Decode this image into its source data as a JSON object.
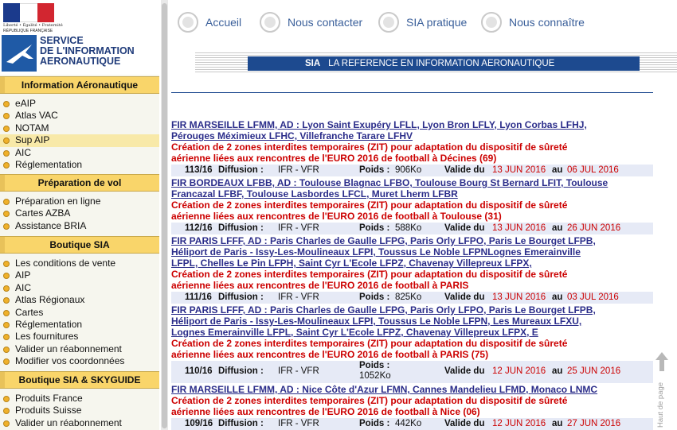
{
  "logo": {
    "motto": "Liberté • Égalité • Fraternité",
    "republic": "RÉPUBLIQUE FRANÇAISE",
    "line1": "SERVICE",
    "line2": "DE L'INFORMATION",
    "line3": "AERONAUTIQUE"
  },
  "sidebar": {
    "sections": [
      {
        "title": "Information Aéronautique",
        "items": [
          "eAIP",
          "Atlas VAC",
          "NOTAM",
          "Sup AIP",
          "AIC",
          "Réglementation"
        ]
      },
      {
        "title": "Préparation de vol",
        "items": [
          "Préparation en ligne",
          "Cartes AZBA",
          "Assistance BRIA"
        ]
      },
      {
        "title": "Boutique SIA",
        "items": [
          "Les conditions de vente",
          "AIP",
          "AIC",
          "Atlas Régionaux",
          "Cartes",
          "Réglementation",
          "Les fournitures",
          "Valider un réabonnement",
          "Modifier vos coordonnées"
        ]
      },
      {
        "title": "Boutique SIA & SKYGUIDE",
        "items": [
          "Produits France",
          "Produits Suisse",
          "Valider un réabonnement"
        ]
      }
    ]
  },
  "nav": {
    "accueil": "Accueil",
    "contact": "Nous contacter",
    "pratique": "SIA pratique",
    "connaitre": "Nous connaître"
  },
  "banner": {
    "sia": "SIA",
    "tagline": "LA REFERENCE EN INFORMATION AERONAUTIQUE"
  },
  "labels": {
    "diffusion": "Diffusion :",
    "poids": "Poids :",
    "valide": "Valide du",
    "au": "au",
    "haut_de_page": "Haut de page"
  },
  "entries": [
    {
      "title": "FIR MARSEILLE LFMM, AD : Lyon Saint Exupéry LFLL, Lyon Bron LFLY, Lyon Corbas LFHJ,\nPérouges Méximieux LFHC, Villefranche Tarare LFHV",
      "desc": "Création de 2 zones interdites temporaires (ZIT) pour adaptation du dispositif de sûreté\naérienne liées aux rencontres de l'EURO 2016 de football à Décines (69)",
      "number": "113/16",
      "type": "IFR - VFR",
      "size": "906Ko",
      "from": "13 JUN 2016",
      "to": "06 JUL 2016"
    },
    {
      "title": "FIR BORDEAUX LFBB, AD : Toulouse Blagnac LFBO, Toulouse Bourg St Bernard LFIT, Toulouse\nFrancazal LFBF, Toulouse Lasbordes LFCL, Muret Lherm LFBR",
      "desc": "Création de 2 zones interdites temporaires (ZIT) pour adaptation du dispositif de sûreté\naérienne liées aux rencontres de l'EURO 2016 de football à Toulouse (31)",
      "number": "112/16",
      "type": "IFR - VFR",
      "size": "588Ko",
      "from": "13 JUN 2016",
      "to": "26 JUN 2016"
    },
    {
      "title": "FIR PARIS LFFF, AD : Paris Charles de Gaulle LFPG, Paris Orly LFPO, Paris Le Bourget LFPB,\nHéliport de Paris - Issy-Les-Moulineaux LFPI, Toussus Le Noble LFPNLognes Emerainville\nLFPL, Chelles Le Pin LFPH, Saint Cyr L'Ecole LFPZ, Chavenay Villepreux LFPX,",
      "desc": "Création de 2 zones interdites temporaires (ZIT) pour adaptation du dispositif de sûreté\naérienne liées aux rencontres de l'EURO 2016 de football à PARIS",
      "number": "111/16",
      "type": "IFR - VFR",
      "size": "825Ko",
      "from": "13 JUN 2016",
      "to": "03 JUL 2016"
    },
    {
      "title": "FIR PARIS LFFF, AD : Paris Charles de Gaulle LFPG, Paris Orly LFPO, Paris Le Bourget LFPB,\nHéliport de Paris - Issy-Les-Moulineaux LFPI, Toussus Le Noble LFPN, Les Mureaux LFXU,\nLognes Emerainville LFPL, Saint Cyr L'Ecole LFPZ, Chavenay Villepreux LFPX, E",
      "desc": "Création de 2 zones interdites temporaires (ZIT) pour adaptation du dispositif de sûreté\naérienne liées aux rencontres de l'EURO 2016 de football à PARIS (75)",
      "number": "110/16",
      "type": "IFR - VFR",
      "size": "1052Ko",
      "from": "12 JUN 2016",
      "to": "25 JUN 2016"
    },
    {
      "title": "FIR MARSEILLE LFMM, AD : Nice Côte d'Azur LFMN, Cannes Mandelieu LFMD, Monaco LNMC",
      "desc": "Création de 2 zones interdites temporaires (ZIT) pour adaptation du dispositif de sûreté\naérienne liées aux rencontres de l'EURO 2016 de football à Nice (06)",
      "number": "109/16",
      "type": "IFR - VFR",
      "size": "442Ko",
      "from": "12 JUN 2016",
      "to": "27 JUN 2016"
    }
  ],
  "colors": {
    "header_yellow": "#f9d56a",
    "bullet_orange": "#f0b12a",
    "banner_blue": "#1d4a8f",
    "title_blue": "#2b2d8a",
    "alert_red": "#cc0000",
    "meta_bg": "#e6eaf6"
  },
  "icons": {
    "nav": "grey-circle-icon",
    "bullet": "orange-dot-icon",
    "back_to_top": "up-arrow-icon"
  }
}
